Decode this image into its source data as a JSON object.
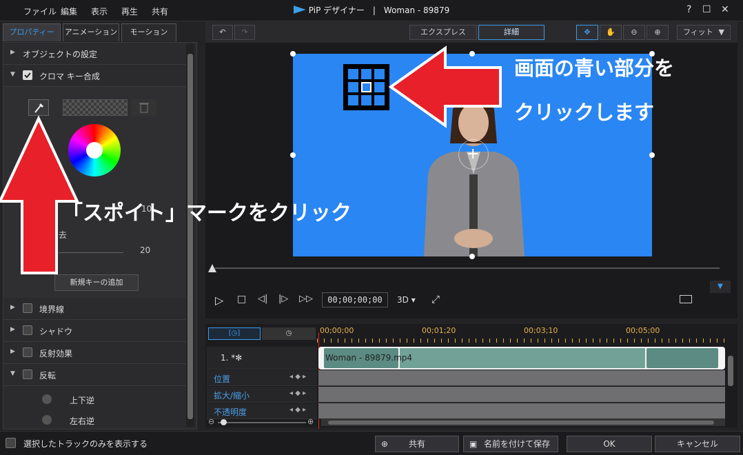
{
  "menu": {
    "file": "ファイル",
    "edit": "編集",
    "view": "表示",
    "play": "再生",
    "share": "共有"
  },
  "window": {
    "title": "PiP デザイナー　|　Woman - 89879",
    "help": "?",
    "maximize": "☐",
    "close": "✕"
  },
  "tabs": {
    "properties": "プロパティー",
    "animation": "アニメーション",
    "motion": "モーション"
  },
  "sections": {
    "object_settings": "オブジェクトの設定",
    "chroma_key": "クロマ キー合成",
    "border": "境界線",
    "shadow": "シャドウ",
    "reflection": "反射効果",
    "flip": "反転"
  },
  "chroma": {
    "value1": "10",
    "value2": "20",
    "partial_label": "去",
    "add_key": "新規キーの追加"
  },
  "flip_options": {
    "vertical": "上下逆",
    "horizontal": "左右逆"
  },
  "preview_toolbar": {
    "express": "エクスプレス",
    "detail": "詳細",
    "fit": "フィット"
  },
  "player": {
    "timecode": "00;00;00;00",
    "mode_3d": "3D"
  },
  "timeline": {
    "ticks": [
      "00;00;00",
      "00;01;20",
      "00;03;10",
      "00;05;00"
    ],
    "track_label": "1. *✻",
    "clip_name": "Woman - 89879.mp4",
    "rows": [
      "位置",
      "拡大/縮小",
      "不透明度"
    ]
  },
  "bottom": {
    "show_selected": "選択したトラックのみを表示する",
    "share": "共有",
    "save_as": "名前を付けて保存",
    "ok": "OK",
    "cancel": "キャンセル"
  },
  "annotations": {
    "click_blue_line1": "画面の青い部分を",
    "click_blue_line2": "クリックします",
    "eyedropper": "「スポイト」マークをクリック"
  },
  "colors": {
    "accent": "#3d9be9",
    "chroma_blue": "#2a86f2",
    "arrow_red": "#e8202a",
    "timecode": "#e8b34b"
  }
}
